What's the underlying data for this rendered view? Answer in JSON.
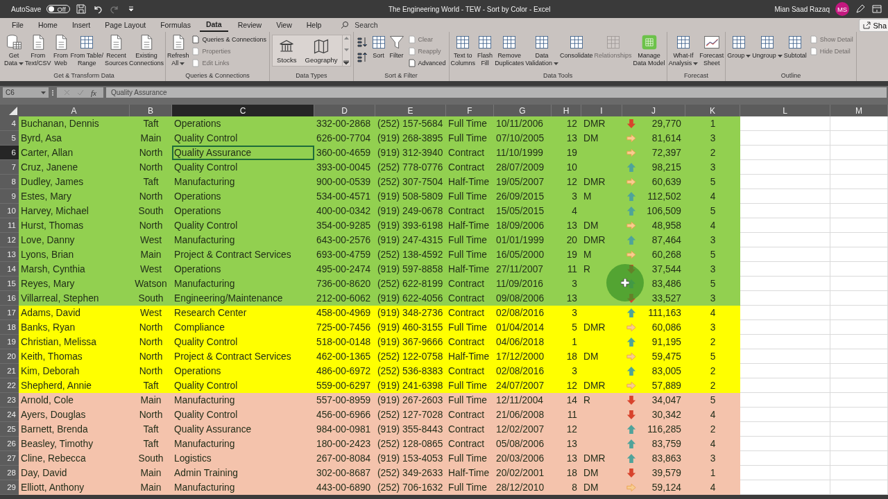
{
  "title_bar": {
    "autosave_label": "AutoSave",
    "autosave_toggle": {
      "label": "Off",
      "on": false
    },
    "title": "The Engineering World - TEW - Sort by Color  -  Excel",
    "user": "Mian Saad Razaq",
    "avatar": "MS"
  },
  "menu_tabs": [
    {
      "label": "File",
      "selected": false
    },
    {
      "label": "Home",
      "selected": false
    },
    {
      "label": "Insert",
      "selected": false
    },
    {
      "label": "Page Layout",
      "selected": false
    },
    {
      "label": "Formulas",
      "selected": false
    },
    {
      "label": "Data",
      "selected": true
    },
    {
      "label": "Review",
      "selected": false
    },
    {
      "label": "View",
      "selected": false
    },
    {
      "label": "Help",
      "selected": false
    }
  ],
  "search": {
    "placeholder": "Search"
  },
  "share_button": "Sha",
  "ribbon": [
    {
      "label": "Get & Transform Data",
      "items": [
        {
          "kind": "large",
          "label": "Get\nData",
          "dropdown": true,
          "disabled": false
        },
        {
          "kind": "large",
          "label": "From\nText/CSV",
          "dropdown": false,
          "disabled": false
        },
        {
          "kind": "large",
          "label": "From\nWeb",
          "dropdown": false,
          "disabled": false
        },
        {
          "kind": "large",
          "label": "From Table/\nRange",
          "dropdown": false,
          "disabled": false
        },
        {
          "kind": "large",
          "label": "Recent\nSources",
          "dropdown": false,
          "disabled": false
        },
        {
          "kind": "large",
          "label": "Existing\nConnections",
          "dropdown": false,
          "disabled": false
        }
      ]
    },
    {
      "label": "Queries & Connections",
      "items": [
        {
          "kind": "large",
          "label": "Refresh\nAll",
          "dropdown": true,
          "disabled": false
        },
        {
          "kind": "small",
          "label": "Queries & Connections",
          "disabled": false
        },
        {
          "kind": "small",
          "label": "Properties",
          "disabled": true
        },
        {
          "kind": "small",
          "label": "Edit Links",
          "disabled": true
        }
      ]
    },
    {
      "label": "Data Types",
      "items": [
        {
          "kind": "gallery",
          "options": [
            "Stocks",
            "Geography"
          ]
        }
      ]
    },
    {
      "label": "Sort & Filter",
      "items": [
        {
          "kind": "sort-pair"
        },
        {
          "kind": "large",
          "label": "Sort",
          "dropdown": false,
          "disabled": false
        },
        {
          "kind": "large",
          "label": "Filter",
          "dropdown": false,
          "disabled": false
        },
        {
          "kind": "small",
          "label": "Clear",
          "disabled": true
        },
        {
          "kind": "small",
          "label": "Reapply",
          "disabled": true
        },
        {
          "kind": "small",
          "label": "Advanced",
          "disabled": false
        }
      ]
    },
    {
      "label": "Data Tools",
      "items": [
        {
          "kind": "large",
          "label": "Text to\nColumns",
          "dropdown": false,
          "disabled": false
        },
        {
          "kind": "large",
          "label": "Flash\nFill",
          "dropdown": false,
          "disabled": false
        },
        {
          "kind": "large",
          "label": "Remove\nDuplicates",
          "dropdown": false,
          "disabled": false
        },
        {
          "kind": "large",
          "label": "Data\nValidation",
          "dropdown": true,
          "disabled": false
        },
        {
          "kind": "large",
          "label": "Consolidate",
          "dropdown": false,
          "disabled": false
        },
        {
          "kind": "large",
          "label": "Relationships",
          "dropdown": false,
          "disabled": true
        },
        {
          "kind": "large",
          "label": "Manage\nData Model",
          "dropdown": false,
          "disabled": false
        }
      ]
    },
    {
      "label": "Forecast",
      "items": [
        {
          "kind": "large",
          "label": "What-If\nAnalysis",
          "dropdown": true,
          "disabled": false
        },
        {
          "kind": "large",
          "label": "Forecast\nSheet",
          "dropdown": false,
          "disabled": false
        }
      ]
    },
    {
      "label": "Outline",
      "items": [
        {
          "kind": "large",
          "label": "Group",
          "dropdown": true,
          "disabled": false
        },
        {
          "kind": "large",
          "label": "Ungroup",
          "dropdown": true,
          "disabled": false
        },
        {
          "kind": "large",
          "label": "Subtotal",
          "dropdown": false,
          "disabled": false
        },
        {
          "kind": "small",
          "label": "Show Detail",
          "disabled": true
        },
        {
          "kind": "small",
          "label": "Hide Detail",
          "disabled": true
        }
      ]
    }
  ],
  "formula_bar": {
    "name_box": "C6",
    "fx": "fx",
    "value": "Quality Assurance"
  },
  "columns": [
    {
      "label": "A",
      "selected": false
    },
    {
      "label": "B",
      "selected": false
    },
    {
      "label": "C",
      "selected": true
    },
    {
      "label": "D",
      "selected": false
    },
    {
      "label": "E",
      "selected": false
    },
    {
      "label": "F",
      "selected": false
    },
    {
      "label": "G",
      "selected": false
    },
    {
      "label": "H",
      "selected": false
    },
    {
      "label": "I",
      "selected": false
    },
    {
      "label": "J",
      "selected": false
    },
    {
      "label": "K",
      "selected": false
    },
    {
      "label": "L",
      "selected": false
    },
    {
      "label": "M",
      "selected": false
    }
  ],
  "rows": [
    {
      "number": "4",
      "selected": false,
      "color": "#92d050",
      "indicator": {
        "kind": "down"
      },
      "A": "Buchanan, Dennis",
      "B": "Taft",
      "C": "Operations",
      "D": "332-00-2868",
      "E": "(252) 157-5684",
      "F": "Full Time",
      "G": "10/11/2006",
      "H": "12",
      "I": "DMR",
      "J": "29,770",
      "K": "1"
    },
    {
      "number": "5",
      "selected": false,
      "color": "#92d050",
      "indicator": {
        "kind": "right"
      },
      "A": "Byrd, Asa",
      "B": "Main",
      "C": "Quality Control",
      "D": "626-00-7704",
      "E": "(919) 268-3895",
      "F": "Full Time",
      "G": "07/10/2005",
      "H": "13",
      "I": "DM",
      "J": "81,614",
      "K": "3"
    },
    {
      "number": "6",
      "selected": true,
      "color": "#92d050",
      "indicator": {
        "kind": "right"
      },
      "A": "Carter, Allan",
      "B": "North",
      "C": "Quality Assurance",
      "D": "360-00-4659",
      "E": "(919) 312-3940",
      "F": "Contract",
      "G": "11/10/1999",
      "H": "19",
      "J": "72,397",
      "K": "2"
    },
    {
      "number": "7",
      "selected": false,
      "color": "#92d050",
      "indicator": {
        "kind": "up"
      },
      "A": "Cruz, Janene",
      "B": "North",
      "C": "Quality Control",
      "D": "393-00-0045",
      "E": "(252) 778-0776",
      "F": "Contract",
      "G": "28/07/2009",
      "H": "10",
      "J": "98,215",
      "K": "3"
    },
    {
      "number": "8",
      "selected": false,
      "color": "#92d050",
      "indicator": {
        "kind": "right"
      },
      "A": "Dudley, James",
      "B": "Taft",
      "C": "Manufacturing",
      "D": "900-00-0539",
      "E": "(252) 307-7504",
      "F": "Half-Time",
      "G": "19/05/2007",
      "H": "12",
      "I": "DMR",
      "J": "60,639",
      "K": "5"
    },
    {
      "number": "9",
      "selected": false,
      "color": "#92d050",
      "indicator": {
        "kind": "up"
      },
      "A": "Estes, Mary",
      "B": "North",
      "C": "Operations",
      "D": "534-00-4571",
      "E": "(919) 508-5809",
      "F": "Full Time",
      "G": "26/09/2015",
      "H": "3",
      "I": "M",
      "J": "112,502",
      "K": "4"
    },
    {
      "number": "10",
      "selected": false,
      "color": "#92d050",
      "indicator": {
        "kind": "up"
      },
      "A": "Harvey, Michael",
      "B": "South",
      "C": "Operations",
      "D": "400-00-0342",
      "E": "(919) 249-0678",
      "F": "Contract",
      "G": "15/05/2015",
      "H": "4",
      "J": "106,509",
      "K": "5"
    },
    {
      "number": "11",
      "selected": false,
      "color": "#92d050",
      "indicator": {
        "kind": "right"
      },
      "A": "Hurst, Thomas",
      "B": "North",
      "C": "Quality Control",
      "D": "354-00-9285",
      "E": "(919) 393-6198",
      "F": "Half-Time",
      "G": "18/09/2006",
      "H": "13",
      "I": "DM",
      "J": "48,958",
      "K": "4"
    },
    {
      "number": "12",
      "selected": false,
      "color": "#92d050",
      "indicator": {
        "kind": "up"
      },
      "A": "Love, Danny",
      "B": "West",
      "C": "Manufacturing",
      "D": "643-00-2576",
      "E": "(919) 247-4315",
      "F": "Full Time",
      "G": "01/01/1999",
      "H": "20",
      "I": "DMR",
      "J": "87,464",
      "K": "3"
    },
    {
      "number": "13",
      "selected": false,
      "color": "#92d050",
      "indicator": {
        "kind": "right"
      },
      "A": "Lyons, Brian",
      "B": "Main",
      "C": "Project & Contract Services",
      "D": "693-00-4759",
      "E": "(252) 138-4592",
      "F": "Full Time",
      "G": "16/05/2000",
      "H": "19",
      "I": "M",
      "J": "60,268",
      "K": "5"
    },
    {
      "number": "14",
      "selected": false,
      "color": "#92d050",
      "indicator": {
        "kind": "down"
      },
      "A": "Marsh, Cynthia",
      "B": "West",
      "C": "Operations",
      "D": "495-00-2474",
      "E": "(919) 597-8858",
      "F": "Half-Time",
      "G": "27/11/2007",
      "H": "11",
      "I": "R",
      "J": "37,544",
      "K": "3"
    },
    {
      "number": "15",
      "selected": false,
      "color": "#92d050",
      "indicator": {
        "kind": "up"
      },
      "A": "Reyes, Mary",
      "B": "Watson",
      "C": "Manufacturing",
      "D": "736-00-8620",
      "E": "(252) 622-8199",
      "F": "Contract",
      "G": "11/09/2016",
      "H": "3",
      "J": "83,486",
      "K": "5"
    },
    {
      "number": "16",
      "selected": false,
      "color": "#92d050",
      "indicator": {
        "kind": "down"
      },
      "A": "Villarreal, Stephen",
      "B": "South",
      "C": "Engineering/Maintenance",
      "D": "212-00-6062",
      "E": "(919) 622-4056",
      "F": "Contract",
      "G": "09/08/2006",
      "H": "13",
      "J": "33,527",
      "K": "3"
    },
    {
      "number": "17",
      "selected": false,
      "color": "#ffff00",
      "indicator": {
        "kind": "up"
      },
      "A": "Adams, David",
      "B": "West",
      "C": "Research Center",
      "D": "458-00-4969",
      "E": "(919) 348-2736",
      "F": "Contract",
      "G": "02/08/2016",
      "H": "3",
      "J": "111,163",
      "K": "4"
    },
    {
      "number": "18",
      "selected": false,
      "color": "#ffff00",
      "indicator": {
        "kind": "right"
      },
      "A": "Banks, Ryan",
      "B": "North",
      "C": "Compliance",
      "D": "725-00-7456",
      "E": "(919) 460-3155",
      "F": "Full Time",
      "G": "01/04/2014",
      "H": "5",
      "I": "DMR",
      "J": "60,086",
      "K": "3"
    },
    {
      "number": "19",
      "selected": false,
      "color": "#ffff00",
      "indicator": {
        "kind": "up"
      },
      "A": "Christian, Melissa",
      "B": "North",
      "C": "Quality Control",
      "D": "518-00-0148",
      "E": "(919) 367-9666",
      "F": "Contract",
      "G": "04/06/2018",
      "H": "1",
      "J": "91,195",
      "K": "2"
    },
    {
      "number": "20",
      "selected": false,
      "color": "#ffff00",
      "indicator": {
        "kind": "right"
      },
      "A": "Keith, Thomas",
      "B": "North",
      "C": "Project & Contract Services",
      "D": "462-00-1365",
      "E": "(252) 122-0758",
      "F": "Half-Time",
      "G": "17/12/2000",
      "H": "18",
      "I": "DM",
      "J": "59,475",
      "K": "5"
    },
    {
      "number": "21",
      "selected": false,
      "color": "#ffff00",
      "indicator": {
        "kind": "up"
      },
      "A": "Kim, Deborah",
      "B": "North",
      "C": "Operations",
      "D": "486-00-6972",
      "E": "(252) 536-8383",
      "F": "Contract",
      "G": "02/08/2016",
      "H": "3",
      "J": "83,005",
      "K": "2"
    },
    {
      "number": "22",
      "selected": false,
      "color": "#ffff00",
      "indicator": {
        "kind": "right"
      },
      "A": "Shepherd, Annie",
      "B": "Taft",
      "C": "Quality Control",
      "D": "559-00-6297",
      "E": "(919) 241-6398",
      "F": "Full Time",
      "G": "24/07/2007",
      "H": "12",
      "I": "DMR",
      "J": "57,889",
      "K": "2"
    },
    {
      "number": "23",
      "selected": false,
      "color": "#f4c3ac",
      "indicator": {
        "kind": "down"
      },
      "A": "Arnold, Cole",
      "B": "Main",
      "C": "Manufacturing",
      "D": "557-00-8959",
      "E": "(919) 267-2603",
      "F": "Full Time",
      "G": "12/11/2004",
      "H": "14",
      "I": "R",
      "J": "34,047",
      "K": "5"
    },
    {
      "number": "24",
      "selected": false,
      "color": "#f4c3ac",
      "indicator": {
        "kind": "down"
      },
      "A": "Ayers, Douglas",
      "B": "North",
      "C": "Quality Control",
      "D": "456-00-6966",
      "E": "(252) 127-7028",
      "F": "Contract",
      "G": "21/06/2008",
      "H": "11",
      "J": "30,342",
      "K": "4"
    },
    {
      "number": "25",
      "selected": false,
      "color": "#f4c3ac",
      "indicator": {
        "kind": "up"
      },
      "A": "Barnett, Brenda",
      "B": "Taft",
      "C": "Quality Assurance",
      "D": "984-00-0981",
      "E": "(919) 355-8443",
      "F": "Contract",
      "G": "12/02/2007",
      "H": "12",
      "J": "116,285",
      "K": "2"
    },
    {
      "number": "26",
      "selected": false,
      "color": "#f4c3ac",
      "indicator": {
        "kind": "up"
      },
      "A": "Beasley, Timothy",
      "B": "Taft",
      "C": "Manufacturing",
      "D": "180-00-2423",
      "E": "(252) 128-0865",
      "F": "Contract",
      "G": "05/08/2006",
      "H": "13",
      "J": "83,759",
      "K": "4"
    },
    {
      "number": "27",
      "selected": false,
      "color": "#f4c3ac",
      "indicator": {
        "kind": "up"
      },
      "A": "Cline, Rebecca",
      "B": "South",
      "C": "Logistics",
      "D": "267-00-8084",
      "E": "(919) 153-4053",
      "F": "Full Time",
      "G": "20/03/2006",
      "H": "13",
      "I": "DMR",
      "J": "83,863",
      "K": "3"
    },
    {
      "number": "28",
      "selected": false,
      "color": "#f4c3ac",
      "indicator": {
        "kind": "down"
      },
      "A": "Day, David",
      "B": "Main",
      "C": "Admin Training",
      "D": "302-00-8687",
      "E": "(252) 349-2633",
      "F": "Half-Time",
      "G": "20/02/2001",
      "H": "18",
      "I": "DM",
      "J": "39,579",
      "K": "1"
    },
    {
      "number": "29",
      "selected": false,
      "color": "#f4c3ac",
      "indicator": {
        "kind": "right"
      },
      "A": "Elliott, Anthony",
      "B": "Main",
      "C": "Manufacturing",
      "D": "443-00-6890",
      "E": "(252) 706-1632",
      "F": "Full Time",
      "G": "28/12/2010",
      "H": "8",
      "I": "DM",
      "J": "59,124",
      "K": "4"
    }
  ]
}
